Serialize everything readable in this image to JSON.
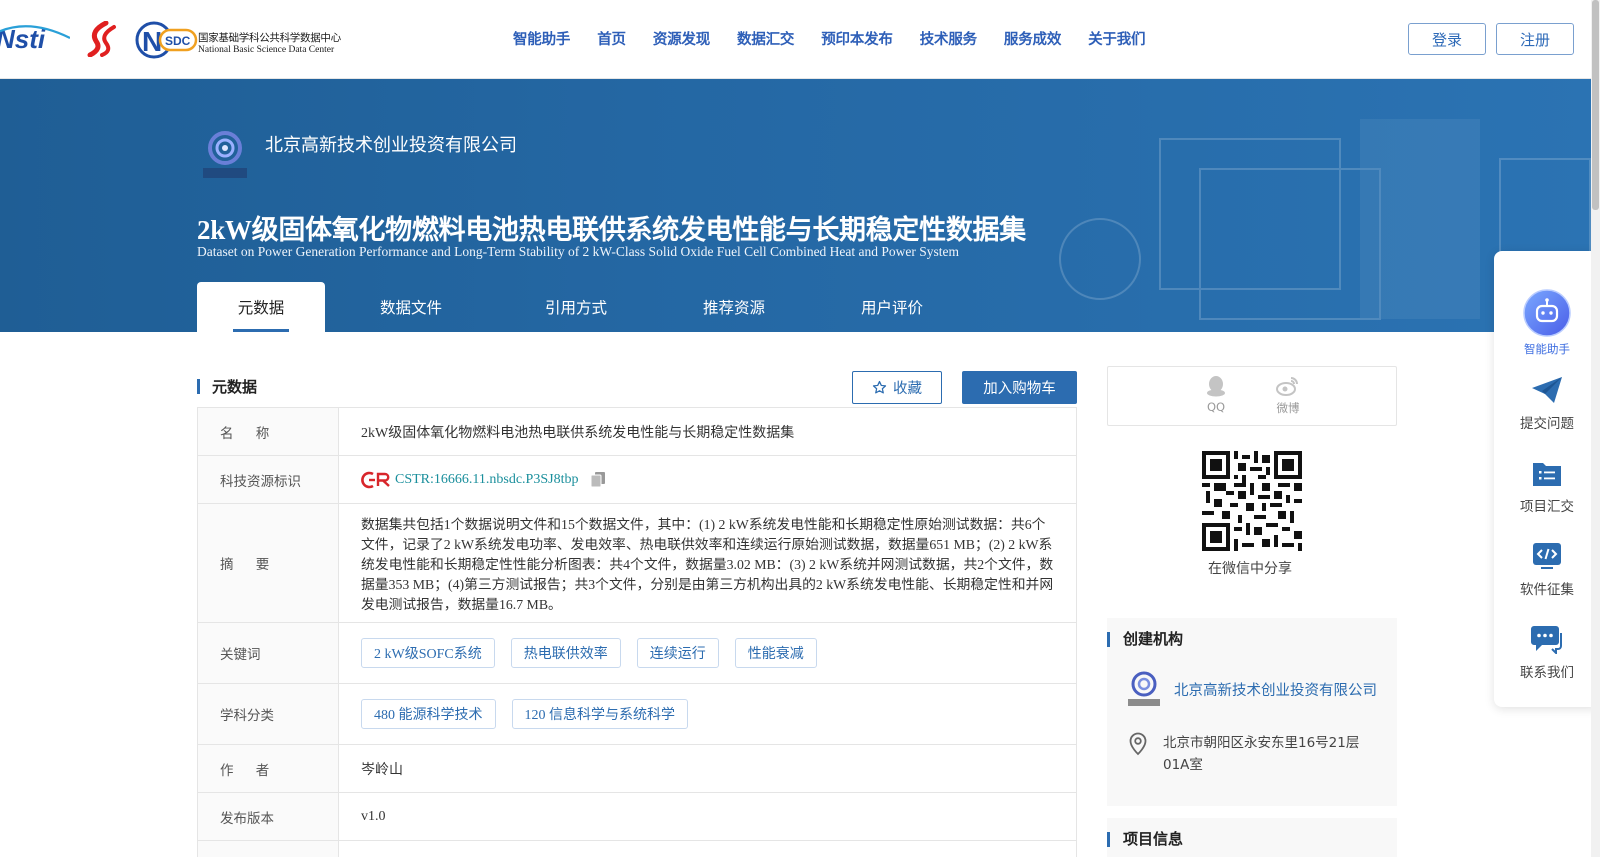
{
  "header": {
    "logo_cn": "国家基础学科公共科学数据中心",
    "logo_en": "National Basic Science Data Center",
    "nav": [
      "智能助手",
      "首页",
      "资源发现",
      "数据汇交",
      "预印本发布",
      "技术服务",
      "服务成效",
      "关于我们"
    ],
    "login_label": "登录",
    "register_label": "注册"
  },
  "banner": {
    "org_name": "北京高新技术创业投资有限公司",
    "title": "2kW级固体氧化物燃料电池热电联供系统发电性能与长期稳定性数据集",
    "title_en": "Dataset on Power Generation Performance and Long-Term Stability of 2 kW-Class Solid Oxide Fuel Cell Combined Heat and Power System",
    "tabs": [
      "元数据",
      "数据文件",
      "引用方式",
      "推荐资源",
      "用户评价"
    ],
    "active_tab": 0
  },
  "metadata_section": {
    "title": "元数据",
    "favorite_label": "收藏",
    "cart_label": "加入购物车",
    "rows": {
      "name": {
        "label": "名 称",
        "value": "2kW级固体氧化物燃料电池热电联供系统发电性能与长期稳定性数据集"
      },
      "cstr": {
        "label": "科技资源标识",
        "value": "CSTR:16666.11.nbsdc.P3SJ8tbp"
      },
      "abstract": {
        "label": "摘 要",
        "value": "数据集共包括1个数据说明文件和15个数据文件，其中：(1) 2 kW系统发电性能和长期稳定性原始测试数据：共6个文件，记录了2 kW系统发电功率、发电效率、热电联供效率和连续运行原始测试数据，数据量651 MB；(2) 2 kW系统发电性能和长期稳定性性能分析图表：共4个文件，数据量3.02 MB：(3) 2 kW系统并网测试数据，共2个文件，数据量353 MB；(4)第三方测试报告；共3个文件，分别是由第三方机构出具的2 kW系统发电性能、长期稳定性和并网发电测试报告，数据量16.7 MB。"
      },
      "keywords": {
        "label": "关键词",
        "tags": [
          "2 kW级SOFC系统",
          "热电联供效率",
          "连续运行",
          "性能衰减"
        ]
      },
      "subjects": {
        "label": "学科分类",
        "tags": [
          "480 能源科学技术",
          "120 信息科学与系统科学"
        ]
      },
      "author": {
        "label": "作 者",
        "value": "岑岭山"
      },
      "version": {
        "label": "发布版本",
        "value": "v1.0"
      }
    }
  },
  "share": {
    "qq_label": "QQ",
    "weibo_label": "微博",
    "wechat_caption": "在微信中分享"
  },
  "creator_card": {
    "title": "创建机构",
    "org_name": "北京高新技术创业投资有限公司",
    "address": "北京市朝阳区永安东里16号21层01A室"
  },
  "project_card": {
    "title": "项目信息"
  },
  "side_panel": {
    "items": [
      "智能助手",
      "提交问题",
      "项目汇交",
      "软件征集",
      "联系我们"
    ]
  },
  "colors": {
    "brand_blue": "#2c6cb0",
    "banner_blue": "#2467a3",
    "cstr_teal": "#1a8f9c"
  }
}
